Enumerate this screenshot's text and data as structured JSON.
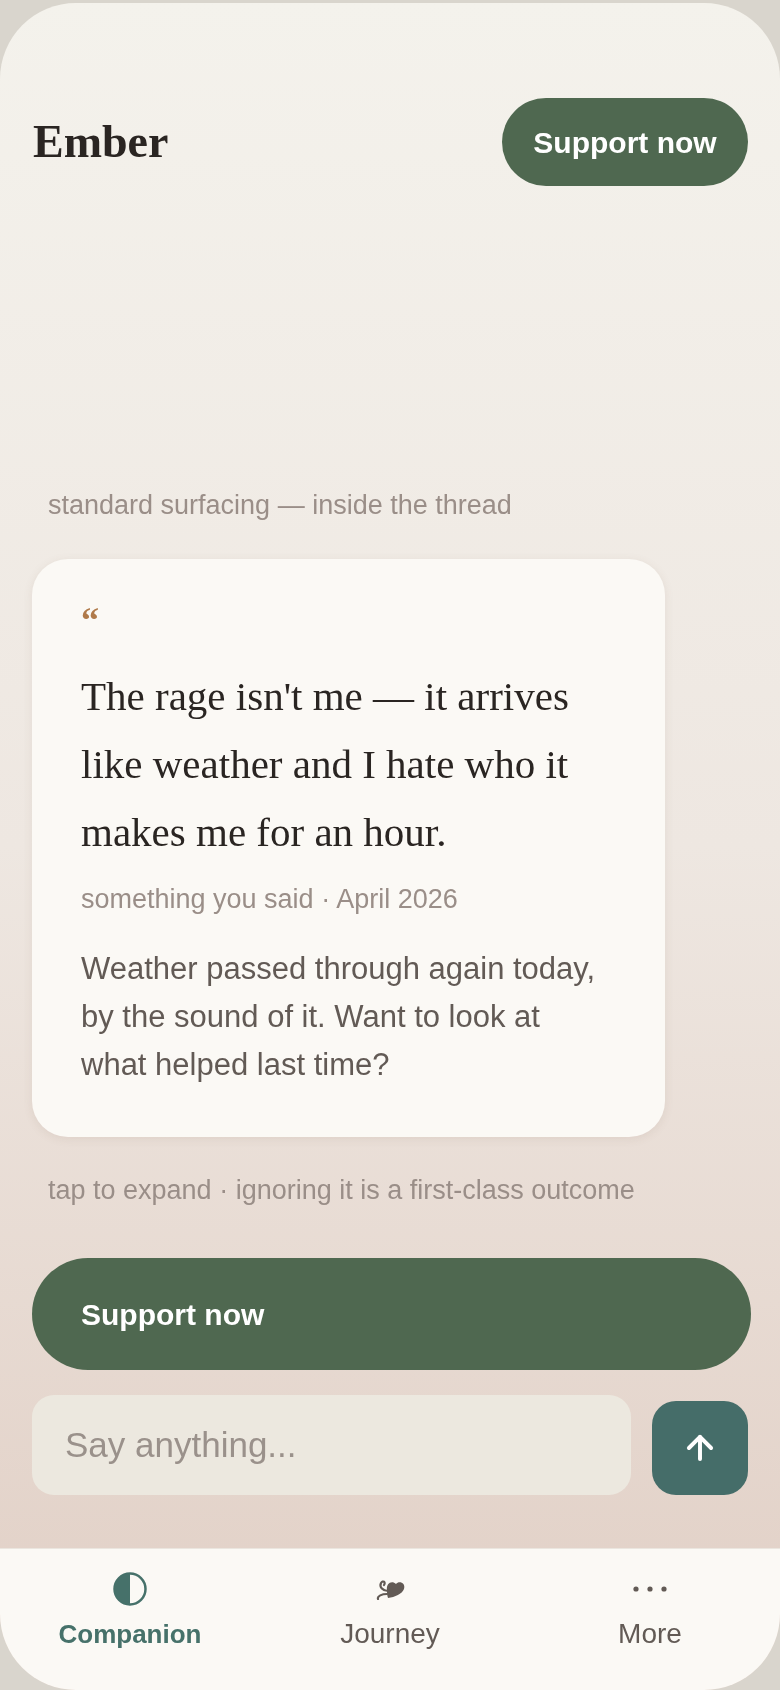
{
  "header": {
    "title": "Ember",
    "support_button": "Support now"
  },
  "thread": {
    "caption": "standard surfacing — inside the thread",
    "card": {
      "quote_mark": "“",
      "quote": "The rage isn't me — it arrives like weather and I hate who it makes me for an hour.",
      "attribution": "something you said · April 2026",
      "prompt": "Weather passed through again today, by the sound of it. Want to look at what helped last time?"
    },
    "footnote": "tap to expand · ignoring it is a first-class outcome"
  },
  "support_button": "Support now",
  "composer": {
    "placeholder": "Say anything..."
  },
  "nav": [
    {
      "label": "Companion",
      "kind": "companion",
      "selected": true
    },
    {
      "label": "Journey",
      "kind": "journey",
      "selected": false
    },
    {
      "label": "More",
      "kind": "more",
      "selected": false
    }
  ]
}
